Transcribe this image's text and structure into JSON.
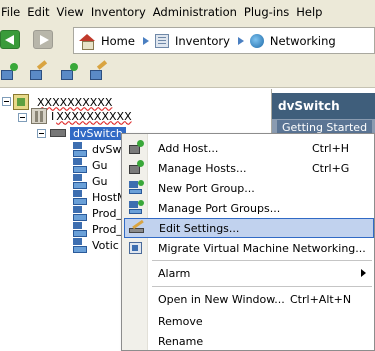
{
  "menubar": {
    "items": [
      "File",
      "Edit",
      "View",
      "Inventory",
      "Administration",
      "Plug-ins",
      "Help"
    ]
  },
  "navbar": {
    "breadcrumbs": [
      "Home",
      "Inventory",
      "Networking"
    ]
  },
  "tree": {
    "vcenter_label": "XXXXXXXXXX",
    "datacenter_label": "XXXXXXXXXX",
    "datacenter_prefix": "I",
    "selected_label": "dvSwitch",
    "children": [
      "dvSwi",
      "Gu",
      "Gu",
      "HostM",
      "Prod_",
      "Prod_",
      "Votic"
    ]
  },
  "right_panel": {
    "title": "dvSwitch",
    "tab": "Getting Started"
  },
  "context_menu": {
    "items": [
      {
        "label": "Add Host...",
        "shortcut": "Ctrl+H",
        "icon": "add-host-icon"
      },
      {
        "label": "Manage Hosts...",
        "shortcut": "Ctrl+G",
        "icon": "manage-hosts-icon"
      },
      {
        "label": "New Port Group...",
        "shortcut": "",
        "icon": "new-port-group-icon"
      },
      {
        "label": "Manage Port Groups...",
        "shortcut": "",
        "icon": "manage-port-groups-icon"
      },
      {
        "label": "Edit Settings...",
        "shortcut": "",
        "icon": "edit-settings-icon"
      },
      {
        "label": "Migrate Virtual Machine Networking...",
        "shortcut": "",
        "icon": "migrate-icon"
      },
      {
        "label": "Alarm",
        "shortcut": "",
        "icon": ""
      },
      {
        "label": "Open in New Window...",
        "shortcut": "Ctrl+Alt+N",
        "icon": ""
      },
      {
        "label": "Remove",
        "shortcut": "",
        "icon": ""
      },
      {
        "label": "Rename",
        "shortcut": "",
        "icon": ""
      }
    ],
    "highlighted": "Edit Settings..."
  },
  "colors": {
    "selection": "#316ac5",
    "highlight": "#c1d2ee",
    "panel_title": "#3f5e7b",
    "chrome": "#ece9d8"
  }
}
